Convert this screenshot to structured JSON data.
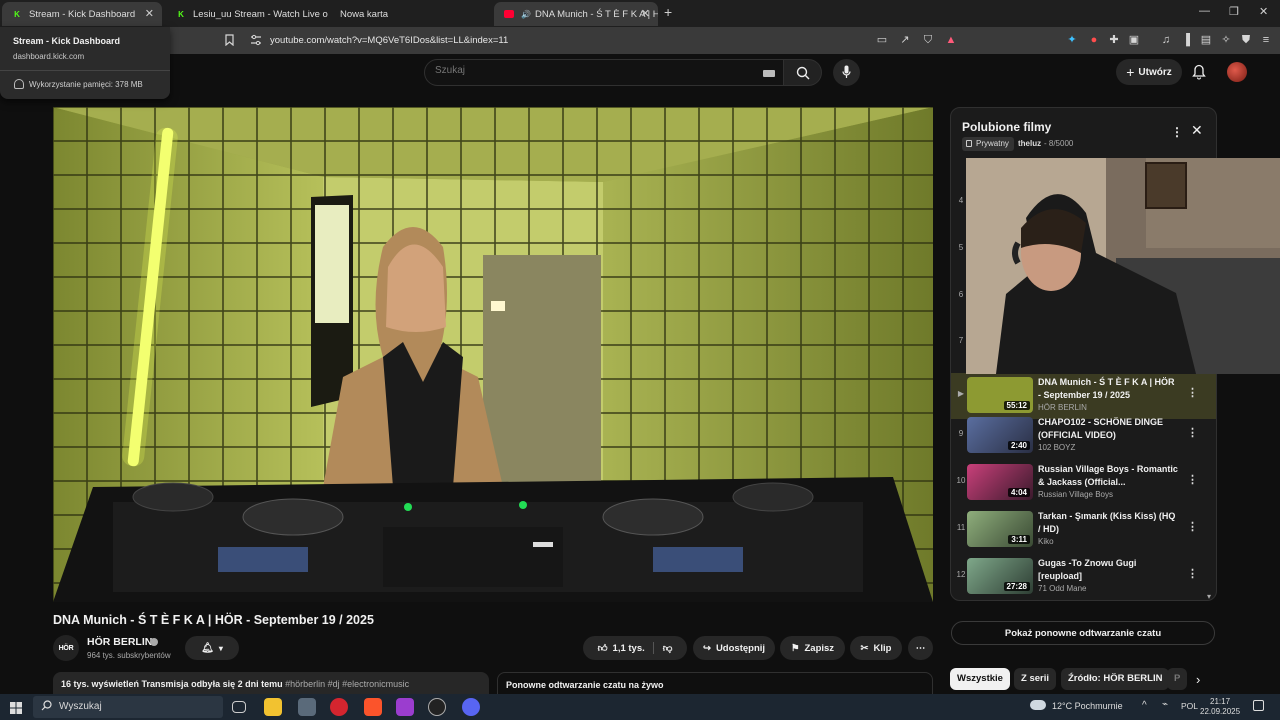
{
  "browser": {
    "tabs": [
      {
        "label": "Stream - Kick Dashboard",
        "favicon": "kick-icon"
      },
      {
        "label": "Lesiu_uu Stream - Watch Live on Kick",
        "favicon": "kick-icon"
      },
      {
        "label": "Nowa karta",
        "favicon": ""
      },
      {
        "label": "DNA Munich - Ś T È F K A | H",
        "favicon": "youtube-icon"
      }
    ],
    "url": "youtube.com/watch?v=MQ6VeT6IDos&list=LL&index=11",
    "tab_popup": {
      "title": "Stream - Kick Dashboard",
      "domain": "dashboard.kick.com",
      "memory": "Wykorzystanie pamięci: 378 MB"
    }
  },
  "header": {
    "search_placeholder": "Szukaj",
    "create_label": "Utwórz"
  },
  "video": {
    "title": "DNA Munich - Ś T È F K A | HÖR - September 19 / 2025",
    "channel": {
      "name": "HÖR BERLIN",
      "subs": "964 tys. subskrybentów",
      "avatar_text": "HÖR"
    },
    "likes": "1,1 tys.",
    "share_label": "Udostępnij",
    "save_label": "Zapisz",
    "clip_label": "Klip",
    "stats": "16 tys. wyświetleń  Transmisja odbyła się 2 dni temu",
    "tags": "#hörberlin #dj #electronicmusic",
    "chat_replay_title": "Ponowne odtwarzanie czatu na żywo"
  },
  "playlist": {
    "title": "Polubione filmy",
    "privacy": "Prywatny",
    "owner": "theluz",
    "count": "- 8/5000",
    "hidden_indices": [
      "4",
      "5",
      "6",
      "7"
    ],
    "items": [
      {
        "index": "",
        "title": "DNA Munich - Ś T È F K A | HÖR - September 19 / 2025",
        "channel": "HÖR BERLIN",
        "duration": "55:12",
        "current": true,
        "thumb_color": "#8d9a32"
      },
      {
        "index": "9",
        "title": "CHAPO102 - SCHÖNE DINGE (OFFICIAL VIDEO)",
        "channel": "102 BOYZ",
        "duration": "2:40",
        "current": false,
        "thumb_color": "#3f4a6a"
      },
      {
        "index": "10",
        "title": "Russian Village Boys - Romantic & Jackass (Official...",
        "channel": "Russian Village Boys",
        "duration": "4:04",
        "current": false,
        "thumb_color": "#b0345c"
      },
      {
        "index": "11",
        "title": "Tarkan - Şımarık (Kiss Kiss) (HQ / HD)",
        "channel": "Kiko",
        "duration": "3:11",
        "current": false,
        "thumb_color": "#6b8a6a"
      },
      {
        "index": "12",
        "title": "Gugas -To Znowu Gugi [reupload]",
        "channel": "71 Odd Mane",
        "duration": "27:28",
        "current": false,
        "thumb_color": "#6a8e74"
      }
    ]
  },
  "sidebar": {
    "replay_button": "Pokaż ponowne odtwarzanie czatu",
    "chips": [
      "Wszystkie",
      "Z serii",
      "Źródło: HÖR BERLIN",
      "P"
    ]
  },
  "taskbar": {
    "search_label": "Wyszukaj",
    "weather": "12°C  Pochmurnie",
    "lang": "POL",
    "time": "21:17",
    "date": "22.09.2025"
  }
}
